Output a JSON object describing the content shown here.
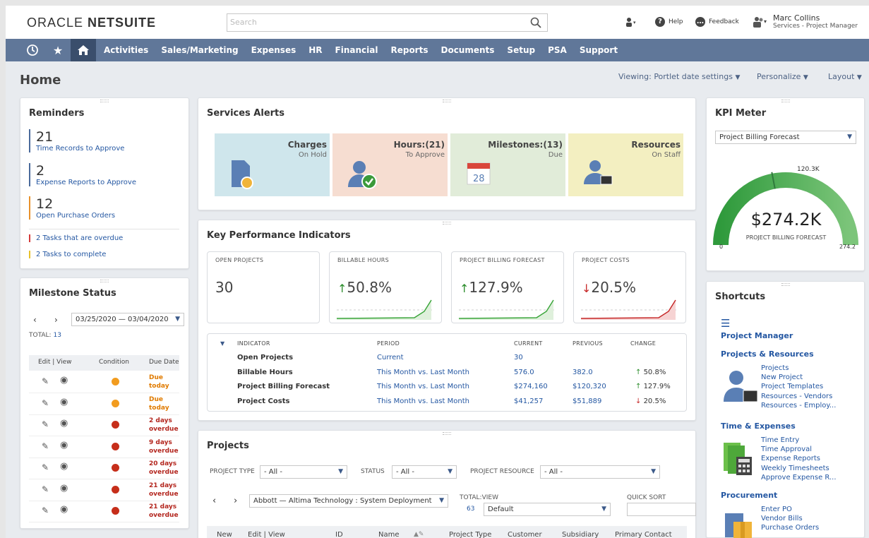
{
  "header": {
    "logo_a": "ORACLE",
    "logo_b": "NETSUITE",
    "search_placeholder": "Search",
    "help": "Help",
    "feedback": "Feedback",
    "user_name": "Marc Collins",
    "user_role": "Services - Project Manager"
  },
  "nav": [
    "Activities",
    "Sales/Marketing",
    "Expenses",
    "HR",
    "Financial",
    "Reports",
    "Documents",
    "Setup",
    "PSA",
    "Support"
  ],
  "page": {
    "title": "Home",
    "viewing": "Viewing: Portlet date settings",
    "personalize": "Personalize",
    "layout": "Layout"
  },
  "reminders": {
    "title": "Reminders",
    "items": [
      {
        "count": "21",
        "label": "Time Records to Approve"
      },
      {
        "count": "2",
        "label": "Expense Reports to Approve"
      },
      {
        "count": "12",
        "label": "Open Purchase Orders"
      }
    ],
    "tasks": [
      "2 Tasks that are overdue",
      "2 Tasks to complete"
    ]
  },
  "milestone": {
    "title": "Milestone Status",
    "range": "03/25/2020 — 03/04/2020",
    "total_label": "TOTAL:",
    "total": "13",
    "cols": [
      "Edit | View",
      "Condition",
      "Due Date"
    ],
    "rows": [
      {
        "due1": "Due",
        "due2": "today",
        "color": "#f29c1f"
      },
      {
        "due1": "Due",
        "due2": "today",
        "color": "#f29c1f"
      },
      {
        "due1": "2 days",
        "due2": "overdue",
        "color": "#c62e1a"
      },
      {
        "due1": "9 days",
        "due2": "overdue",
        "color": "#c62e1a"
      },
      {
        "due1": "20 days",
        "due2": "overdue",
        "color": "#c62e1a"
      },
      {
        "due1": "21 days",
        "due2": "overdue",
        "color": "#c62e1a"
      },
      {
        "due1": "21 days",
        "due2": "overdue",
        "color": "#c62e1a"
      }
    ]
  },
  "alerts": {
    "title": "Services Alerts",
    "items": [
      {
        "t": "Charges",
        "s": "On Hold",
        "bg": "#cfe6ec"
      },
      {
        "t": "Hours:(21)",
        "s": "To Approve",
        "bg": "#f6ddd1"
      },
      {
        "t": "Milestones:(13)",
        "s": "Due",
        "bg": "#e1ecd9"
      },
      {
        "t": "Resources",
        "s": "On Staff",
        "bg": "#f3efc1"
      }
    ]
  },
  "kpi": {
    "title": "Key Performance Indicators",
    "boxes": [
      {
        "t": "OPEN PROJECTS",
        "v": "30",
        "dir": "none"
      },
      {
        "t": "BILLABLE HOURS",
        "v": "50.8%",
        "dir": "up"
      },
      {
        "t": "PROJECT BILLING FORECAST",
        "v": "127.9%",
        "dir": "up"
      },
      {
        "t": "PROJECT COSTS",
        "v": "20.5%",
        "dir": "down"
      }
    ],
    "cols": [
      "INDICATOR",
      "PERIOD",
      "CURRENT",
      "PREVIOUS",
      "CHANGE"
    ],
    "rows": [
      {
        "ind": "Open Projects",
        "per": "Current",
        "cur": "30",
        "prev": "",
        "chg": "",
        "dir": "none"
      },
      {
        "ind": "Billable Hours",
        "per": "This Month vs. Last Month",
        "cur": "576.0",
        "prev": "382.0",
        "chg": "50.8%",
        "dir": "up"
      },
      {
        "ind": "Project Billing Forecast",
        "per": "This Month vs. Last Month",
        "cur": "$274,160",
        "prev": "$120,320",
        "chg": "127.9%",
        "dir": "up"
      },
      {
        "ind": "Project Costs",
        "per": "This Month vs. Last Month",
        "cur": "$41,257",
        "prev": "$51,889",
        "chg": "20.5%",
        "dir": "down"
      }
    ]
  },
  "projects": {
    "title": "Projects",
    "f_type": "PROJECT TYPE",
    "f_type_v": "- All -",
    "f_status": "STATUS",
    "f_status_v": "- All -",
    "f_res": "PROJECT RESOURCE",
    "f_res_v": "- All -",
    "selected": "Abbott — Altima Technology : System Deployment",
    "total_view": "TOTAL:VIEW",
    "total": "63",
    "view": "Default",
    "quick_sort": "QUICK SORT",
    "cols": [
      "New",
      "Edit | View",
      "ID",
      "Name",
      "Project Type",
      "Customer",
      "Subsidiary",
      "Primary Contact"
    ]
  },
  "kpi_meter": {
    "title": "KPI Meter",
    "select": "Project Billing Forecast",
    "value": "$274.2K",
    "label": "PROJECT BILLING FORECAST",
    "target": "120.3K",
    "min": "0",
    "max": "274.2",
    "fraction": 1.0,
    "target_fraction": 0.44
  },
  "shortcuts": {
    "title": "Shortcuts",
    "pm": "Project Manager",
    "groups": [
      {
        "h": "Projects & Resources",
        "links": [
          "Projects",
          "New Project",
          "Project Templates",
          "Resources - Vendors",
          "Resources - Employ..."
        ]
      },
      {
        "h": "Time & Expenses",
        "links": [
          "Time Entry",
          "Time Approval",
          "Expense Reports",
          "Weekly Timesheets",
          "Approve Expense R..."
        ]
      },
      {
        "h": "Procurement",
        "links": [
          "Enter PO",
          "Vendor Bills",
          "Purchase Orders"
        ]
      }
    ]
  }
}
